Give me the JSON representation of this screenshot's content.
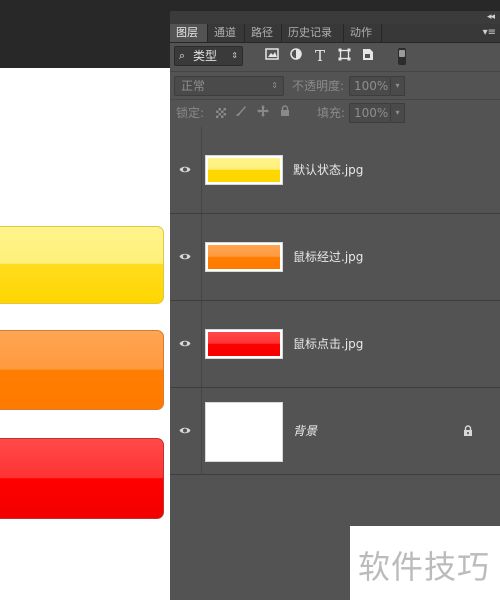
{
  "panel": {
    "tabs": [
      {
        "label": "图层",
        "active": true
      },
      {
        "label": "通道",
        "active": false
      },
      {
        "label": "路径",
        "active": false
      },
      {
        "label": "历史记录",
        "active": false
      },
      {
        "label": "动作",
        "active": false
      }
    ],
    "collapse_glyph": "◂◂",
    "menu_glyph": "▾≡"
  },
  "filter": {
    "kind_label": "类型",
    "icons": [
      "image-filter-icon",
      "adjustment-filter-icon",
      "type-filter-icon",
      "shape-filter-icon",
      "smart-object-filter-icon"
    ]
  },
  "blend": {
    "mode": "正常",
    "opacity_label": "不透明度:",
    "opacity_value": "100%"
  },
  "lock": {
    "label": "锁定:",
    "fill_label": "填充:",
    "fill_value": "100%"
  },
  "layers": [
    {
      "name": "默认状态.jpg",
      "visible": true,
      "locked": false,
      "color": "#ffd600"
    },
    {
      "name": "鼠标经过.jpg",
      "visible": true,
      "locked": false,
      "color": "#ff7e00"
    },
    {
      "name": "鼠标点击.jpg",
      "visible": true,
      "locked": false,
      "color": "#ff0000"
    },
    {
      "name": "背景",
      "visible": true,
      "locked": true,
      "color": "#ffffff"
    }
  ],
  "canvas": {
    "buttons": [
      {
        "state": "default",
        "color": "#ffd600"
      },
      {
        "state": "hover",
        "color": "#ff7e00"
      },
      {
        "state": "pressed",
        "color": "#ff0000"
      }
    ]
  },
  "watermark": {
    "text": "软件技巧"
  }
}
